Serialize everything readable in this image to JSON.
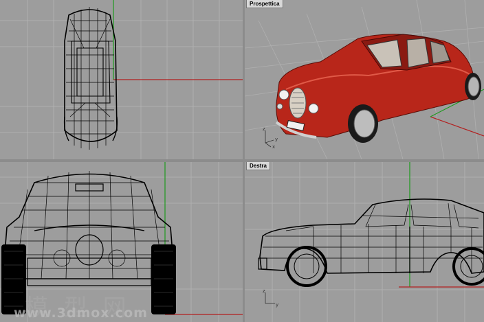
{
  "viewports": {
    "top": {
      "label": ""
    },
    "perspective": {
      "label": "Prospettica"
    },
    "front": {
      "label": ""
    },
    "right": {
      "label": "Destra"
    }
  },
  "axes": {
    "x": "x",
    "y": "y",
    "z": "z"
  },
  "watermark": {
    "chinese": "模 型 网",
    "url": "www.3dmox.com"
  },
  "colors": {
    "grid": "#a8a8a8",
    "background": "#9d9d9d",
    "axis_x": "#b22020",
    "axis_y": "#1e9a1e",
    "car_body": "#c0281c",
    "wire": "#000000"
  }
}
